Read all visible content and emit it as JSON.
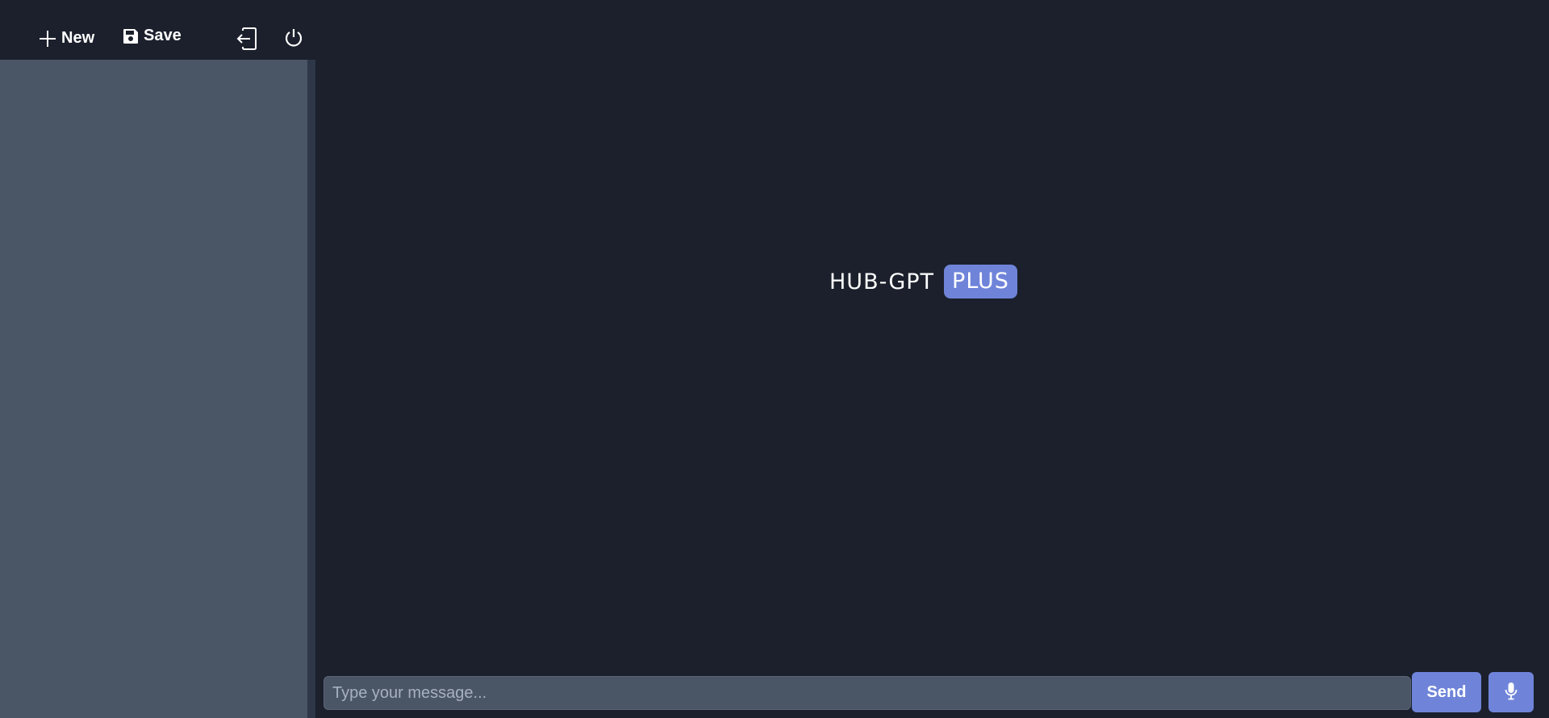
{
  "toolbar": {
    "new_label": "New",
    "new_icon": "plus-icon",
    "save_label": "Save",
    "save_icon": "floppy-disk-icon",
    "logout_icon": "sign-out-icon",
    "power_icon": "power-icon"
  },
  "logo": {
    "text": "HUB-GPT",
    "badge": "PLUS"
  },
  "composer": {
    "placeholder": "Type your message...",
    "value": "",
    "send_label": "Send",
    "mic_icon": "microphone-icon"
  },
  "colors": {
    "background": "#1b202c",
    "sidebar_panel": "#4a5566",
    "accent": "#6f84d9",
    "text": "#ffffff"
  }
}
